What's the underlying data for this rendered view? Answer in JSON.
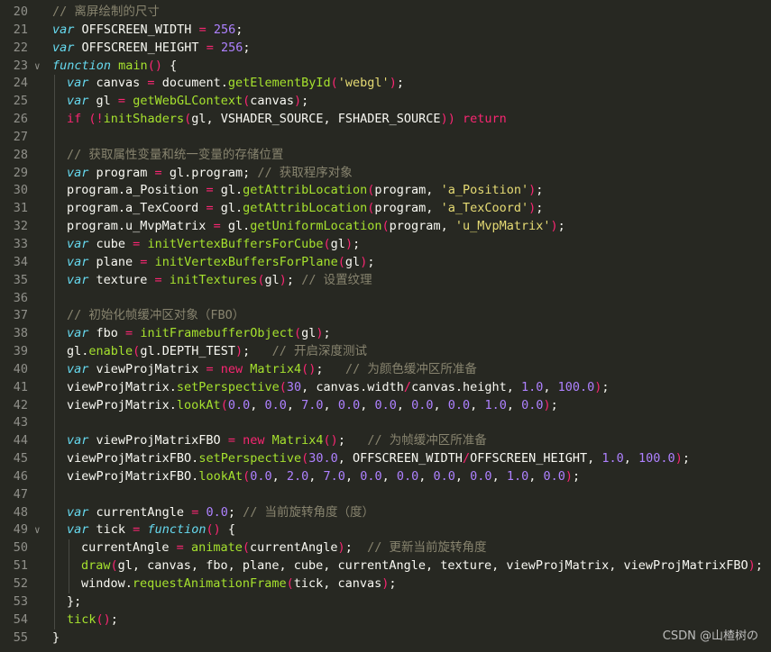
{
  "editor": {
    "lines": [
      {
        "n": "20",
        "fold": "",
        "indent": 0,
        "tokens": [
          [
            "cm",
            "// 离屏绘制的尺寸"
          ]
        ]
      },
      {
        "n": "21",
        "fold": "",
        "indent": 0,
        "tokens": [
          [
            "kw",
            "var"
          ],
          [
            "pl",
            " OFFSCREEN_WIDTH "
          ],
          [
            "op",
            "="
          ],
          [
            "pl",
            " "
          ],
          [
            "num",
            "256"
          ],
          [
            "pl",
            ";"
          ]
        ]
      },
      {
        "n": "22",
        "fold": "",
        "indent": 0,
        "tokens": [
          [
            "kw",
            "var"
          ],
          [
            "pl",
            " OFFSCREEN_HEIGHT "
          ],
          [
            "op",
            "="
          ],
          [
            "pl",
            " "
          ],
          [
            "num",
            "256"
          ],
          [
            "pl",
            ";"
          ]
        ]
      },
      {
        "n": "23",
        "fold": "v",
        "indent": 0,
        "tokens": [
          [
            "kw",
            "function"
          ],
          [
            "pl",
            " "
          ],
          [
            "fn",
            "main"
          ],
          [
            "op",
            "()"
          ],
          [
            "pl",
            " {"
          ]
        ]
      },
      {
        "n": "24",
        "fold": "",
        "indent": 1,
        "tokens": [
          [
            "kw",
            "var"
          ],
          [
            "pl",
            " canvas "
          ],
          [
            "op",
            "="
          ],
          [
            "pl",
            " document."
          ],
          [
            "fn",
            "getElementById"
          ],
          [
            "op",
            "("
          ],
          [
            "str",
            "'webgl'"
          ],
          [
            "op",
            ")"
          ],
          [
            "pl",
            ";"
          ]
        ]
      },
      {
        "n": "25",
        "fold": "",
        "indent": 1,
        "tokens": [
          [
            "kw",
            "var"
          ],
          [
            "pl",
            " gl "
          ],
          [
            "op",
            "="
          ],
          [
            "pl",
            " "
          ],
          [
            "fn",
            "getWebGLContext"
          ],
          [
            "op",
            "("
          ],
          [
            "pl",
            "canvas"
          ],
          [
            "op",
            ")"
          ],
          [
            "pl",
            ";"
          ]
        ]
      },
      {
        "n": "26",
        "fold": "",
        "indent": 1,
        "tokens": [
          [
            "kw2",
            "if"
          ],
          [
            "pl",
            " "
          ],
          [
            "op",
            "(!"
          ],
          [
            "fn",
            "initShaders"
          ],
          [
            "op",
            "("
          ],
          [
            "pl",
            "gl, VSHADER_SOURCE, FSHADER_SOURCE"
          ],
          [
            "op",
            "))"
          ],
          [
            "pl",
            " "
          ],
          [
            "kw2",
            "return"
          ]
        ]
      },
      {
        "n": "27",
        "fold": "",
        "indent": 1,
        "tokens": []
      },
      {
        "n": "28",
        "fold": "",
        "indent": 1,
        "tokens": [
          [
            "cm",
            "// 获取属性变量和统一变量的存储位置"
          ]
        ]
      },
      {
        "n": "29",
        "fold": "",
        "indent": 1,
        "tokens": [
          [
            "kw",
            "var"
          ],
          [
            "pl",
            " program "
          ],
          [
            "op",
            "="
          ],
          [
            "pl",
            " gl.program; "
          ],
          [
            "cm",
            "// 获取程序对象"
          ]
        ]
      },
      {
        "n": "30",
        "fold": "",
        "indent": 1,
        "tokens": [
          [
            "pl",
            "program.a_Position "
          ],
          [
            "op",
            "="
          ],
          [
            "pl",
            " gl."
          ],
          [
            "fn",
            "getAttribLocation"
          ],
          [
            "op",
            "("
          ],
          [
            "pl",
            "program, "
          ],
          [
            "str",
            "'a_Position'"
          ],
          [
            "op",
            ")"
          ],
          [
            "pl",
            ";"
          ]
        ]
      },
      {
        "n": "31",
        "fold": "",
        "indent": 1,
        "tokens": [
          [
            "pl",
            "program.a_TexCoord "
          ],
          [
            "op",
            "="
          ],
          [
            "pl",
            " gl."
          ],
          [
            "fn",
            "getAttribLocation"
          ],
          [
            "op",
            "("
          ],
          [
            "pl",
            "program, "
          ],
          [
            "str",
            "'a_TexCoord'"
          ],
          [
            "op",
            ")"
          ],
          [
            "pl",
            ";"
          ]
        ]
      },
      {
        "n": "32",
        "fold": "",
        "indent": 1,
        "tokens": [
          [
            "pl",
            "program.u_MvpMatrix "
          ],
          [
            "op",
            "="
          ],
          [
            "pl",
            " gl."
          ],
          [
            "fn",
            "getUniformLocation"
          ],
          [
            "op",
            "("
          ],
          [
            "pl",
            "program, "
          ],
          [
            "str",
            "'u_MvpMatrix'"
          ],
          [
            "op",
            ")"
          ],
          [
            "pl",
            ";"
          ]
        ]
      },
      {
        "n": "33",
        "fold": "",
        "indent": 1,
        "tokens": [
          [
            "kw",
            "var"
          ],
          [
            "pl",
            " cube "
          ],
          [
            "op",
            "="
          ],
          [
            "pl",
            " "
          ],
          [
            "fn",
            "initVertexBuffersForCube"
          ],
          [
            "op",
            "("
          ],
          [
            "pl",
            "gl"
          ],
          [
            "op",
            ")"
          ],
          [
            "pl",
            ";"
          ]
        ]
      },
      {
        "n": "34",
        "fold": "",
        "indent": 1,
        "tokens": [
          [
            "kw",
            "var"
          ],
          [
            "pl",
            " plane "
          ],
          [
            "op",
            "="
          ],
          [
            "pl",
            " "
          ],
          [
            "fn",
            "initVertexBuffersForPlane"
          ],
          [
            "op",
            "("
          ],
          [
            "pl",
            "gl"
          ],
          [
            "op",
            ")"
          ],
          [
            "pl",
            ";"
          ]
        ]
      },
      {
        "n": "35",
        "fold": "",
        "indent": 1,
        "tokens": [
          [
            "kw",
            "var"
          ],
          [
            "pl",
            " texture "
          ],
          [
            "op",
            "="
          ],
          [
            "pl",
            " "
          ],
          [
            "fn",
            "initTextures"
          ],
          [
            "op",
            "("
          ],
          [
            "pl",
            "gl"
          ],
          [
            "op",
            ")"
          ],
          [
            "pl",
            "; "
          ],
          [
            "cm",
            "// 设置纹理"
          ]
        ]
      },
      {
        "n": "36",
        "fold": "",
        "indent": 1,
        "tokens": []
      },
      {
        "n": "37",
        "fold": "",
        "indent": 1,
        "tokens": [
          [
            "cm",
            "// 初始化帧缓冲区对象（FBO）"
          ]
        ]
      },
      {
        "n": "38",
        "fold": "",
        "indent": 1,
        "tokens": [
          [
            "kw",
            "var"
          ],
          [
            "pl",
            " fbo "
          ],
          [
            "op",
            "="
          ],
          [
            "pl",
            " "
          ],
          [
            "fn",
            "initFramebufferObject"
          ],
          [
            "op",
            "("
          ],
          [
            "pl",
            "gl"
          ],
          [
            "op",
            ")"
          ],
          [
            "pl",
            ";"
          ]
        ]
      },
      {
        "n": "39",
        "fold": "",
        "indent": 1,
        "tokens": [
          [
            "pl",
            "gl."
          ],
          [
            "fn",
            "enable"
          ],
          [
            "op",
            "("
          ],
          [
            "pl",
            "gl.DEPTH_TEST"
          ],
          [
            "op",
            ")"
          ],
          [
            "pl",
            ";   "
          ],
          [
            "cm",
            "// 开启深度测试"
          ]
        ]
      },
      {
        "n": "40",
        "fold": "",
        "indent": 1,
        "tokens": [
          [
            "kw",
            "var"
          ],
          [
            "pl",
            " viewProjMatrix "
          ],
          [
            "op",
            "="
          ],
          [
            "pl",
            " "
          ],
          [
            "kw2",
            "new"
          ],
          [
            "pl",
            " "
          ],
          [
            "fn",
            "Matrix4"
          ],
          [
            "op",
            "()"
          ],
          [
            "pl",
            ";   "
          ],
          [
            "cm",
            "// 为颜色缓冲区所准备"
          ]
        ]
      },
      {
        "n": "41",
        "fold": "",
        "indent": 1,
        "tokens": [
          [
            "pl",
            "viewProjMatrix."
          ],
          [
            "fn",
            "setPerspective"
          ],
          [
            "op",
            "("
          ],
          [
            "num",
            "30"
          ],
          [
            "pl",
            ", canvas.width"
          ],
          [
            "op",
            "/"
          ],
          [
            "pl",
            "canvas.height, "
          ],
          [
            "num",
            "1.0"
          ],
          [
            "pl",
            ", "
          ],
          [
            "num",
            "100.0"
          ],
          [
            "op",
            ")"
          ],
          [
            "pl",
            ";"
          ]
        ]
      },
      {
        "n": "42",
        "fold": "",
        "indent": 1,
        "tokens": [
          [
            "pl",
            "viewProjMatrix."
          ],
          [
            "fn",
            "lookAt"
          ],
          [
            "op",
            "("
          ],
          [
            "num",
            "0.0"
          ],
          [
            "pl",
            ", "
          ],
          [
            "num",
            "0.0"
          ],
          [
            "pl",
            ", "
          ],
          [
            "num",
            "7.0"
          ],
          [
            "pl",
            ", "
          ],
          [
            "num",
            "0.0"
          ],
          [
            "pl",
            ", "
          ],
          [
            "num",
            "0.0"
          ],
          [
            "pl",
            ", "
          ],
          [
            "num",
            "0.0"
          ],
          [
            "pl",
            ", "
          ],
          [
            "num",
            "0.0"
          ],
          [
            "pl",
            ", "
          ],
          [
            "num",
            "1.0"
          ],
          [
            "pl",
            ", "
          ],
          [
            "num",
            "0.0"
          ],
          [
            "op",
            ")"
          ],
          [
            "pl",
            ";"
          ]
        ]
      },
      {
        "n": "43",
        "fold": "",
        "indent": 1,
        "tokens": []
      },
      {
        "n": "44",
        "fold": "",
        "indent": 1,
        "tokens": [
          [
            "kw",
            "var"
          ],
          [
            "pl",
            " viewProjMatrixFBO "
          ],
          [
            "op",
            "="
          ],
          [
            "pl",
            " "
          ],
          [
            "kw2",
            "new"
          ],
          [
            "pl",
            " "
          ],
          [
            "fn",
            "Matrix4"
          ],
          [
            "op",
            "()"
          ],
          [
            "pl",
            ";   "
          ],
          [
            "cm",
            "// 为帧缓冲区所准备"
          ]
        ]
      },
      {
        "n": "45",
        "fold": "",
        "indent": 1,
        "tokens": [
          [
            "pl",
            "viewProjMatrixFBO."
          ],
          [
            "fn",
            "setPerspective"
          ],
          [
            "op",
            "("
          ],
          [
            "num",
            "30.0"
          ],
          [
            "pl",
            ", OFFSCREEN_WIDTH"
          ],
          [
            "op",
            "/"
          ],
          [
            "pl",
            "OFFSCREEN_HEIGHT, "
          ],
          [
            "num",
            "1.0"
          ],
          [
            "pl",
            ", "
          ],
          [
            "num",
            "100.0"
          ],
          [
            "op",
            ")"
          ],
          [
            "pl",
            ";"
          ]
        ]
      },
      {
        "n": "46",
        "fold": "",
        "indent": 1,
        "tokens": [
          [
            "pl",
            "viewProjMatrixFBO."
          ],
          [
            "fn",
            "lookAt"
          ],
          [
            "op",
            "("
          ],
          [
            "num",
            "0.0"
          ],
          [
            "pl",
            ", "
          ],
          [
            "num",
            "2.0"
          ],
          [
            "pl",
            ", "
          ],
          [
            "num",
            "7.0"
          ],
          [
            "pl",
            ", "
          ],
          [
            "num",
            "0.0"
          ],
          [
            "pl",
            ", "
          ],
          [
            "num",
            "0.0"
          ],
          [
            "pl",
            ", "
          ],
          [
            "num",
            "0.0"
          ],
          [
            "pl",
            ", "
          ],
          [
            "num",
            "0.0"
          ],
          [
            "pl",
            ", "
          ],
          [
            "num",
            "1.0"
          ],
          [
            "pl",
            ", "
          ],
          [
            "num",
            "0.0"
          ],
          [
            "op",
            ")"
          ],
          [
            "pl",
            ";"
          ]
        ]
      },
      {
        "n": "47",
        "fold": "",
        "indent": 1,
        "tokens": []
      },
      {
        "n": "48",
        "fold": "",
        "indent": 1,
        "tokens": [
          [
            "kw",
            "var"
          ],
          [
            "pl",
            " currentAngle "
          ],
          [
            "op",
            "="
          ],
          [
            "pl",
            " "
          ],
          [
            "num",
            "0.0"
          ],
          [
            "pl",
            "; "
          ],
          [
            "cm",
            "// 当前旋转角度（度）"
          ]
        ]
      },
      {
        "n": "49",
        "fold": "v",
        "indent": 1,
        "tokens": [
          [
            "kw",
            "var"
          ],
          [
            "pl",
            " tick "
          ],
          [
            "op",
            "="
          ],
          [
            "pl",
            " "
          ],
          [
            "kw",
            "function"
          ],
          [
            "op",
            "()"
          ],
          [
            "pl",
            " {"
          ]
        ]
      },
      {
        "n": "50",
        "fold": "",
        "indent": 2,
        "tokens": [
          [
            "pl",
            "currentAngle "
          ],
          [
            "op",
            "="
          ],
          [
            "pl",
            " "
          ],
          [
            "fn",
            "animate"
          ],
          [
            "op",
            "("
          ],
          [
            "pl",
            "currentAngle"
          ],
          [
            "op",
            ")"
          ],
          [
            "pl",
            ";  "
          ],
          [
            "cm",
            "// 更新当前旋转角度"
          ]
        ]
      },
      {
        "n": "51",
        "fold": "",
        "indent": 2,
        "tokens": [
          [
            "fn",
            "draw"
          ],
          [
            "op",
            "("
          ],
          [
            "pl",
            "gl, canvas, fbo, plane, cube, currentAngle, texture, viewProjMatrix, viewProjMatrixFBO"
          ],
          [
            "op",
            ")"
          ],
          [
            "pl",
            ";"
          ]
        ]
      },
      {
        "n": "52",
        "fold": "",
        "indent": 2,
        "tokens": [
          [
            "pl",
            "window."
          ],
          [
            "fn",
            "requestAnimationFrame"
          ],
          [
            "op",
            "("
          ],
          [
            "pl",
            "tick, canvas"
          ],
          [
            "op",
            ")"
          ],
          [
            "pl",
            ";"
          ]
        ]
      },
      {
        "n": "53",
        "fold": "",
        "indent": 1,
        "tokens": [
          [
            "pl",
            "};"
          ]
        ]
      },
      {
        "n": "54",
        "fold": "",
        "indent": 1,
        "tokens": [
          [
            "fn",
            "tick"
          ],
          [
            "op",
            "()"
          ],
          [
            "pl",
            ";"
          ]
        ]
      },
      {
        "n": "55",
        "fold": "",
        "indent": 0,
        "tokens": [
          [
            "pl",
            "}"
          ]
        ]
      }
    ]
  },
  "watermark": "CSDN @山楂树の",
  "colors": {
    "background": "#272822",
    "comment": "#88846f",
    "keyword": "#66d9ef",
    "control": "#f92672",
    "function": "#a6e22e",
    "number": "#ae81ff",
    "string": "#e6db74"
  }
}
